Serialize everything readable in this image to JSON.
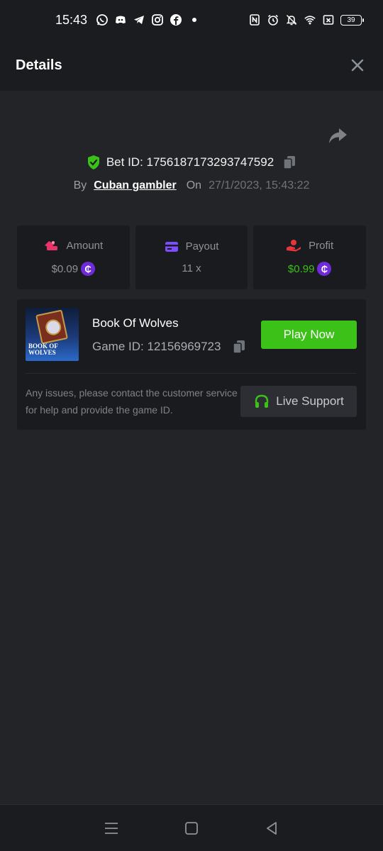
{
  "status_bar": {
    "time": "15:43",
    "battery": "39",
    "left_icons": [
      "whatsapp-icon",
      "discord-icon",
      "telegram-icon",
      "instagram-icon",
      "facebook-icon",
      "dot-icon"
    ],
    "right_icons": [
      "nfc-icon",
      "alarm-icon",
      "mute-icon",
      "wifi-icon",
      "no-sim-icon",
      "battery-icon"
    ]
  },
  "header": {
    "title": "Details"
  },
  "bet": {
    "id_label": "Bet ID: 1756187173293747592",
    "by_label": "By",
    "user": "Cuban gambler",
    "on_label": "On",
    "date": "27/1/2023, 15:43:22"
  },
  "stats": {
    "amount": {
      "label": "Amount",
      "value": "$0.09"
    },
    "payout": {
      "label": "Payout",
      "value": "11 x"
    },
    "profit": {
      "label": "Profit",
      "value": "$0.99"
    }
  },
  "game": {
    "thumb_title": "BOOK OF WOLVES",
    "name": "Book Of Wolves",
    "id_label": "Game ID: 12156969723",
    "play_button": "Play Now",
    "notice": "Any issues, please contact the customer service for help and provide the game ID.",
    "support_button": "Live Support"
  },
  "coin_symbol": "₵",
  "colors": {
    "background": "#232427",
    "bar": "#1b1c1f",
    "card": "#1a1b1e",
    "accent_green": "#3bc117",
    "coin_purple": "#6f2bd9",
    "amount_pink": "#e8336b",
    "payout_purple": "#7c4dff",
    "profit_red": "#e5373a"
  }
}
